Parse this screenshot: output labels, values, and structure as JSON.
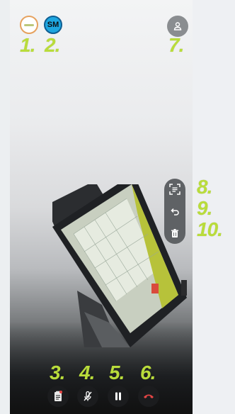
{
  "header": {
    "logo_avatar_icon": "company-logo-icon",
    "user_initials": "SM",
    "participants_icon": "user-icon"
  },
  "annotations": {
    "n1": "1.",
    "n2": "2.",
    "n3": "3.",
    "n4": "4.",
    "n5": "5.",
    "n6": "6.",
    "n7": "7.",
    "n8": "8.",
    "n9": "9.",
    "n10": "10."
  },
  "side_tools": [
    {
      "icon": "scan-text-icon"
    },
    {
      "icon": "undo-icon"
    },
    {
      "icon": "trash-icon"
    }
  ],
  "controls": [
    {
      "icon": "document-icon"
    },
    {
      "icon": "mic-off-icon"
    },
    {
      "icon": "pause-icon"
    },
    {
      "icon": "end-call-icon"
    }
  ],
  "colors": {
    "annotation": "#b9dc3b",
    "end_call": "#e64545",
    "avatar_sm": "#1ea6e0"
  }
}
